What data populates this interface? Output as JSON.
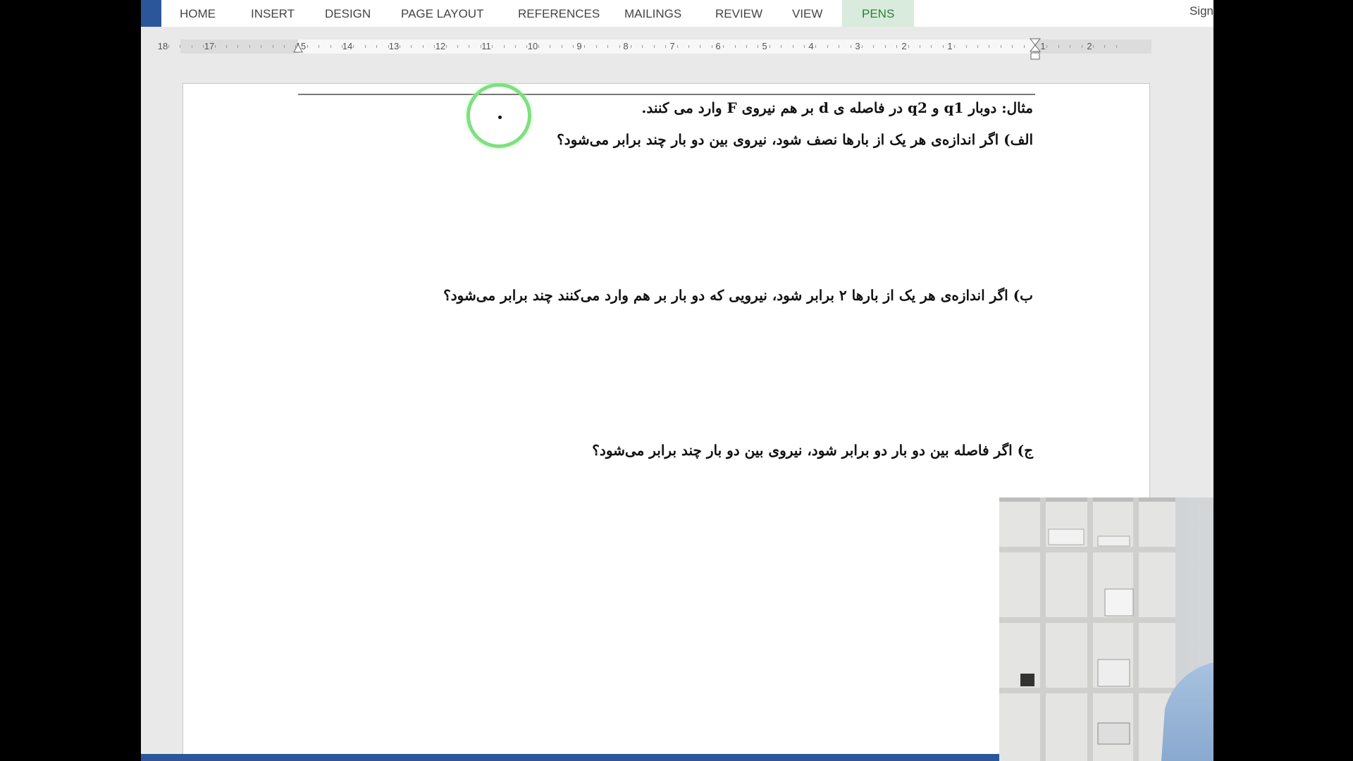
{
  "ribbon": {
    "tabs": [
      {
        "label": "HOME"
      },
      {
        "label": "INSERT"
      },
      {
        "label": "DESIGN"
      },
      {
        "label": "PAGE LAYOUT"
      },
      {
        "label": "REFERENCES"
      },
      {
        "label": "MAILINGS"
      },
      {
        "label": "REVIEW"
      },
      {
        "label": "VIEW"
      },
      {
        "label": "PENS",
        "active": true
      }
    ],
    "signin": "Sign"
  },
  "ruler": {
    "ticks": [
      "18",
      "17",
      "15",
      "14",
      "13",
      "12",
      "11",
      "10",
      "9",
      "8",
      "7",
      "6",
      "5",
      "4",
      "3",
      "2",
      "1",
      "1",
      "2"
    ]
  },
  "document": {
    "line1": "مثال: دوبار q1 و q2 در فاصله ی d بر هم نیروی F وارد می کنند.",
    "line2": "الف) اگر اندازه‌ی هر یک از بارها نصف شود، نیروی بین دو بار چند برابر می‌شود؟",
    "line3": "ب) اگر اندازه‌ی هر یک از بارها ۲ برابر شود، نیرویی که دو بار بر هم وارد می‌کنند چند برابر می‌شود؟",
    "line4": "ج) اگر فاصله بین دو بار دو برابر شود، نیروی بین دو بار چند برابر می‌شود؟"
  },
  "colors": {
    "accent": "#2b579a",
    "pens_tab_bg": "#d8ebdc",
    "pen_cursor": "#7ee07e"
  },
  "icons": {
    "pen_cursor": "circle-cursor-icon",
    "ruler_indent": "indent-marker-icon"
  }
}
